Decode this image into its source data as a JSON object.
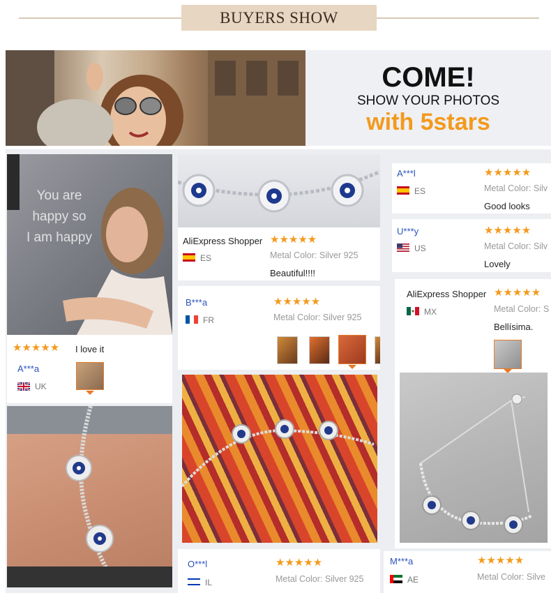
{
  "header": {
    "title": "BUYERS SHOW"
  },
  "banner": {
    "line1": "COME!",
    "line2": "SHOW YOUR PHOTOS",
    "line3": "with 5stars"
  },
  "stars": "★★★★★",
  "photo_overlay": {
    "line1": "You are",
    "line2": "happy so",
    "line3": "I am happy"
  },
  "metal_label": "Metal Color:",
  "reviews": [
    {
      "user": "AliExpress Shopper",
      "country": "ES",
      "metal": "Silver 925",
      "comment": "Beautiful!!!!"
    },
    {
      "user": "A***l",
      "country": "ES",
      "metal": "Silv",
      "comment": "Good looks"
    },
    {
      "user": "U***y",
      "country": "US",
      "metal": "Silv",
      "comment": "Lovely"
    },
    {
      "user": "B***a",
      "country": "FR",
      "metal": "Silver 925",
      "comment": ""
    },
    {
      "user": "AliExpress Shopper",
      "country": "MX",
      "metal": "S",
      "comment": "Bellísima."
    },
    {
      "user": "A***a",
      "country": "UK",
      "metal": "",
      "comment": "I love it"
    },
    {
      "user": "O***l",
      "country": "IL",
      "metal": "Silver 925",
      "comment": ""
    },
    {
      "user": "M***a",
      "country": "AE",
      "metal": "Silve",
      "comment": ""
    }
  ],
  "colors": {
    "accent": "#f39a1c",
    "username": "#2a52be",
    "header_bg": "#e7d6c1",
    "gallery_bg": "#eceef2"
  }
}
